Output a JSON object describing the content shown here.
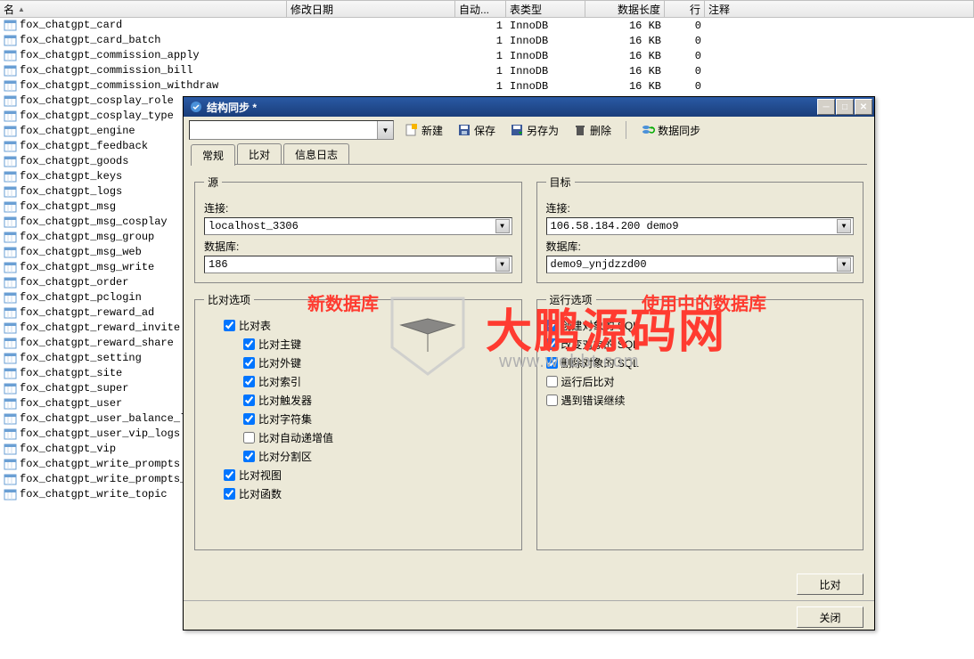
{
  "columns": {
    "name": "名",
    "modified": "修改日期",
    "auto": "自动...",
    "tabletype": "表类型",
    "datalen": "数据长度",
    "rows": "行",
    "comment": "注释"
  },
  "tables": [
    {
      "name": "fox_chatgpt_card",
      "auto": "1",
      "type": "InnoDB",
      "len": "16 KB",
      "rows": "0"
    },
    {
      "name": "fox_chatgpt_card_batch",
      "auto": "1",
      "type": "InnoDB",
      "len": "16 KB",
      "rows": "0"
    },
    {
      "name": "fox_chatgpt_commission_apply",
      "auto": "1",
      "type": "InnoDB",
      "len": "16 KB",
      "rows": "0"
    },
    {
      "name": "fox_chatgpt_commission_bill",
      "auto": "1",
      "type": "InnoDB",
      "len": "16 KB",
      "rows": "0"
    },
    {
      "name": "fox_chatgpt_commission_withdraw",
      "auto": "1",
      "type": "InnoDB",
      "len": "16 KB",
      "rows": "0"
    },
    {
      "name": "fox_chatgpt_cosplay_role",
      "auto": "",
      "type": "",
      "len": "",
      "rows": ""
    },
    {
      "name": "fox_chatgpt_cosplay_type",
      "auto": "",
      "type": "",
      "len": "",
      "rows": ""
    },
    {
      "name": "fox_chatgpt_engine",
      "auto": "",
      "type": "",
      "len": "",
      "rows": ""
    },
    {
      "name": "fox_chatgpt_feedback",
      "auto": "",
      "type": "",
      "len": "",
      "rows": ""
    },
    {
      "name": "fox_chatgpt_goods",
      "auto": "",
      "type": "",
      "len": "",
      "rows": ""
    },
    {
      "name": "fox_chatgpt_keys",
      "auto": "",
      "type": "",
      "len": "",
      "rows": ""
    },
    {
      "name": "fox_chatgpt_logs",
      "auto": "",
      "type": "",
      "len": "",
      "rows": ""
    },
    {
      "name": "fox_chatgpt_msg",
      "auto": "",
      "type": "",
      "len": "",
      "rows": ""
    },
    {
      "name": "fox_chatgpt_msg_cosplay",
      "auto": "",
      "type": "",
      "len": "",
      "rows": ""
    },
    {
      "name": "fox_chatgpt_msg_group",
      "auto": "",
      "type": "",
      "len": "",
      "rows": ""
    },
    {
      "name": "fox_chatgpt_msg_web",
      "auto": "",
      "type": "",
      "len": "",
      "rows": ""
    },
    {
      "name": "fox_chatgpt_msg_write",
      "auto": "",
      "type": "",
      "len": "",
      "rows": ""
    },
    {
      "name": "fox_chatgpt_order",
      "auto": "",
      "type": "",
      "len": "",
      "rows": ""
    },
    {
      "name": "fox_chatgpt_pclogin",
      "auto": "",
      "type": "",
      "len": "",
      "rows": ""
    },
    {
      "name": "fox_chatgpt_reward_ad",
      "auto": "",
      "type": "",
      "len": "",
      "rows": ""
    },
    {
      "name": "fox_chatgpt_reward_invite",
      "auto": "",
      "type": "",
      "len": "",
      "rows": ""
    },
    {
      "name": "fox_chatgpt_reward_share",
      "auto": "",
      "type": "",
      "len": "",
      "rows": ""
    },
    {
      "name": "fox_chatgpt_setting",
      "auto": "",
      "type": "",
      "len": "",
      "rows": ""
    },
    {
      "name": "fox_chatgpt_site",
      "auto": "",
      "type": "",
      "len": "",
      "rows": ""
    },
    {
      "name": "fox_chatgpt_super",
      "auto": "",
      "type": "",
      "len": "",
      "rows": ""
    },
    {
      "name": "fox_chatgpt_user",
      "auto": "",
      "type": "",
      "len": "",
      "rows": ""
    },
    {
      "name": "fox_chatgpt_user_balance_logs",
      "auto": "",
      "type": "",
      "len": "",
      "rows": ""
    },
    {
      "name": "fox_chatgpt_user_vip_logs",
      "auto": "",
      "type": "",
      "len": "",
      "rows": ""
    },
    {
      "name": "fox_chatgpt_vip",
      "auto": "",
      "type": "",
      "len": "",
      "rows": ""
    },
    {
      "name": "fox_chatgpt_write_prompts",
      "auto": "",
      "type": "",
      "len": "",
      "rows": ""
    },
    {
      "name": "fox_chatgpt_write_prompts_v",
      "auto": "",
      "type": "",
      "len": "",
      "rows": ""
    },
    {
      "name": "fox_chatgpt_write_topic",
      "auto": "",
      "type": "",
      "len": "",
      "rows": ""
    }
  ],
  "dialog": {
    "title": "结构同步 *",
    "toolbar": {
      "new": "新建",
      "save": "保存",
      "saveas": "另存为",
      "delete": "删除",
      "sync": "数据同步"
    },
    "tabs": {
      "general": "常规",
      "compare": "比对",
      "log": "信息日志"
    },
    "source": {
      "legend": "源",
      "conn_label": "连接:",
      "conn_value": "localhost_3306",
      "db_label": "数据库:",
      "db_value": "186"
    },
    "target": {
      "legend": "目标",
      "conn_label": "连接:",
      "conn_value": "106.58.184.200 demo9",
      "db_label": "数据库:",
      "db_value": "demo9_ynjdzzd00"
    },
    "compare_opts": {
      "legend": "比对选项",
      "tables": "比对表",
      "pk": "比对主键",
      "fk": "比对外键",
      "idx": "比对索引",
      "trigger": "比对触发器",
      "charset": "比对字符集",
      "autoinc": "比对自动递增值",
      "partition": "比对分割区",
      "views": "比对视图",
      "functions": "比对函数"
    },
    "run_opts": {
      "legend": "运行选项",
      "create_sql": "创建对象的 SQL",
      "alter_sql": "改变对象的 SQL",
      "drop_sql": "删除对象的 SQL",
      "run_after": "运行后比对",
      "continue_err": "遇到错误继续"
    },
    "buttons": {
      "compare": "比对",
      "close": "关闭"
    }
  },
  "annotations": {
    "new_db": "新数据库",
    "using_db": "使用中的数据库"
  },
  "watermark": {
    "text": "大鹏源码网",
    "url": "www.wobbt.com"
  }
}
